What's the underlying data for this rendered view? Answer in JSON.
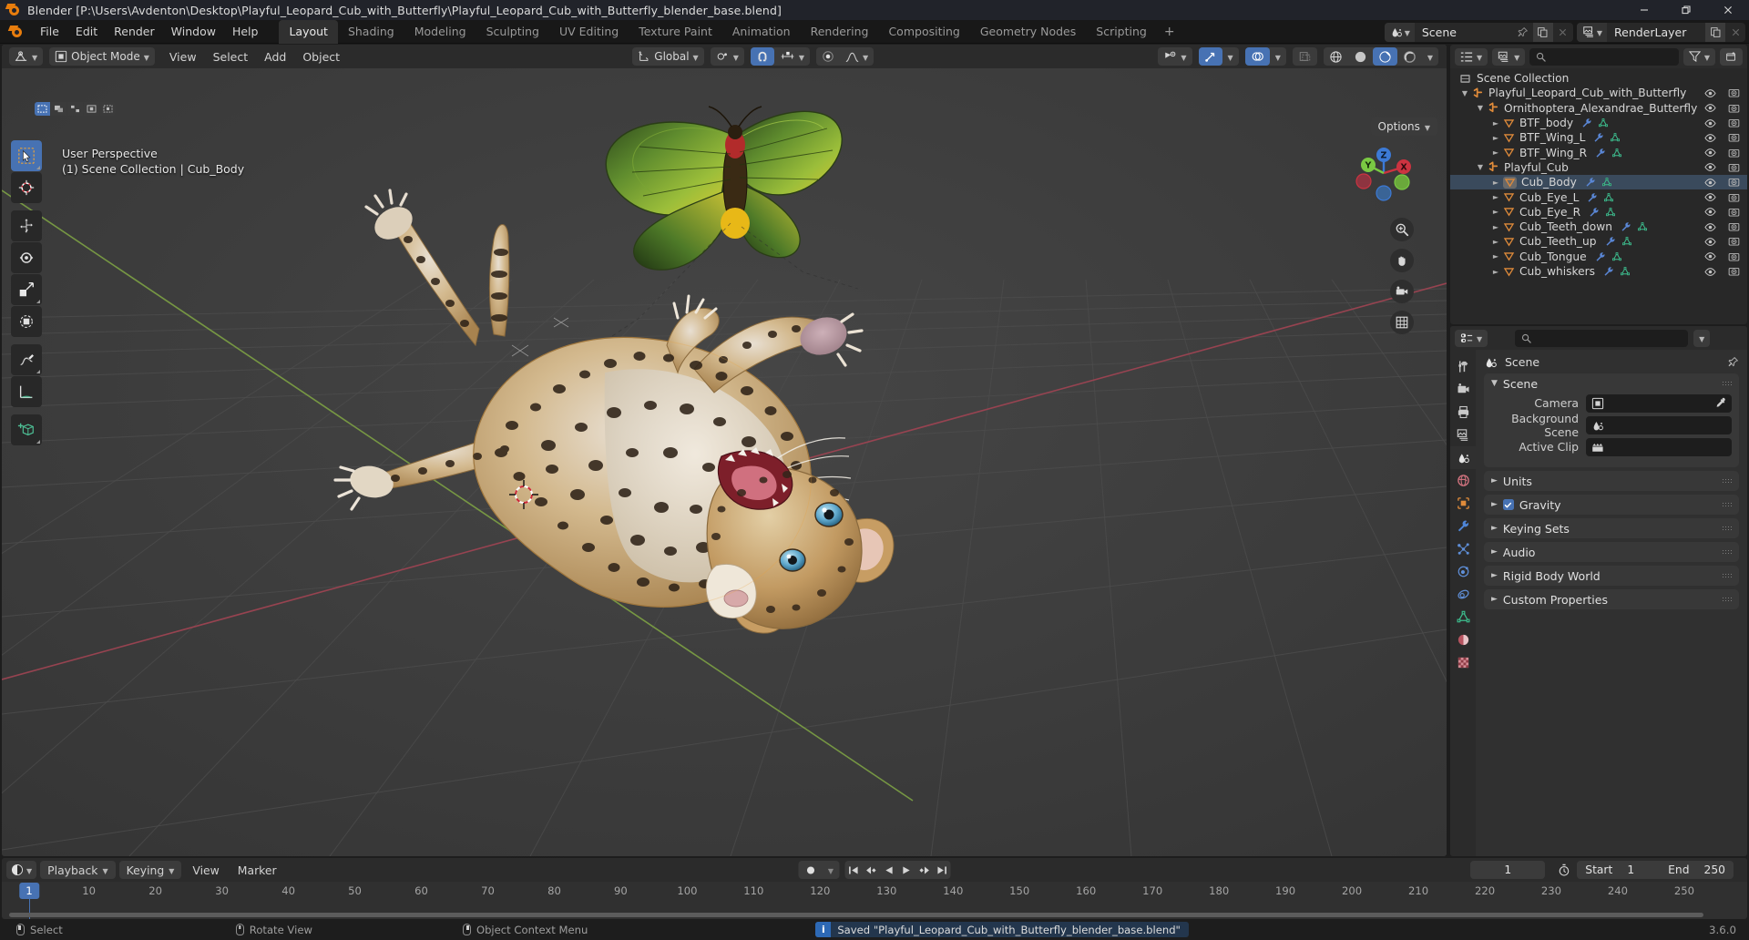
{
  "window": {
    "title": "Blender [P:\\Users\\Avdenton\\Desktop\\Playful_Leopard_Cub_with_Butterfly\\Playful_Leopard_Cub_with_Butterfly_blender_base.blend]",
    "minimize_label": "—",
    "maximize_label": "❐",
    "close_label": "✕"
  },
  "topbar": {
    "menus": [
      "File",
      "Edit",
      "Render",
      "Window",
      "Help"
    ],
    "workspaces": [
      "Layout",
      "Shading",
      "Modeling",
      "Sculpting",
      "UV Editing",
      "Texture Paint",
      "Animation",
      "Rendering",
      "Compositing",
      "Geometry Nodes",
      "Scripting"
    ],
    "active_workspace": "Layout",
    "add_workspace_label": "+",
    "scene_name": "Scene",
    "viewlayer_name": "RenderLayer"
  },
  "viewport": {
    "mode": "Object Mode",
    "menus": [
      "View",
      "Select",
      "Add",
      "Object"
    ],
    "transform_orientation": "Global",
    "options_label": "Options",
    "overlay_line1": "User Perspective",
    "overlay_line2": "(1) Scene Collection | Cub_Body",
    "gizmo_axes": [
      "X",
      "Y",
      "Z"
    ],
    "tools": [
      "tweak-select-tool",
      "cursor-tool",
      "move-tool",
      "rotate-tool",
      "scale-tool",
      "transform-tool",
      "annotate-tool",
      "measure-tool",
      "add-cube-tool"
    ],
    "select_modes": [
      "set-new",
      "extend",
      "subtract",
      "invert",
      "intersect"
    ],
    "shading_modes": [
      "wireframe",
      "solid",
      "material-preview",
      "rendered"
    ],
    "active_shading_mode": "material-preview",
    "nav_buttons": [
      "zoom-navigate",
      "pan-navigate",
      "camera-view",
      "toggle-orthographic"
    ]
  },
  "outliner": {
    "search_placeholder": "",
    "root": "Scene Collection",
    "rows": [
      {
        "label": "Playful_Leopard_Cub_with_Butterfly",
        "indent": 0,
        "type": "collection",
        "expanded": true,
        "disclosure": "down",
        "modifier": false,
        "mesh": false,
        "selected": false
      },
      {
        "label": "Ornithoptera_Alexandrae_Butterfly",
        "indent": 1,
        "type": "collection",
        "expanded": true,
        "disclosure": "down",
        "modifier": false,
        "mesh": false,
        "selected": false
      },
      {
        "label": "BTF_body",
        "indent": 2,
        "type": "object",
        "expanded": false,
        "disclosure": "right",
        "modifier": true,
        "mesh": true,
        "selected": false
      },
      {
        "label": "BTF_Wing_L",
        "indent": 2,
        "type": "object",
        "expanded": false,
        "disclosure": "right",
        "modifier": true,
        "mesh": true,
        "selected": false
      },
      {
        "label": "BTF_Wing_R",
        "indent": 2,
        "type": "object",
        "expanded": false,
        "disclosure": "right",
        "modifier": true,
        "mesh": true,
        "selected": false
      },
      {
        "label": "Playful_Cub",
        "indent": 1,
        "type": "collection",
        "expanded": true,
        "disclosure": "down",
        "modifier": false,
        "mesh": false,
        "selected": false
      },
      {
        "label": "Cub_Body",
        "indent": 2,
        "type": "object",
        "expanded": false,
        "disclosure": "right",
        "modifier": true,
        "mesh": true,
        "selected": true
      },
      {
        "label": "Cub_Eye_L",
        "indent": 2,
        "type": "object",
        "expanded": false,
        "disclosure": "right",
        "modifier": true,
        "mesh": true,
        "selected": false
      },
      {
        "label": "Cub_Eye_R",
        "indent": 2,
        "type": "object",
        "expanded": false,
        "disclosure": "right",
        "modifier": true,
        "mesh": true,
        "selected": false
      },
      {
        "label": "Cub_Teeth_down",
        "indent": 2,
        "type": "object",
        "expanded": false,
        "disclosure": "right",
        "modifier": true,
        "mesh": true,
        "selected": false
      },
      {
        "label": "Cub_Teeth_up",
        "indent": 2,
        "type": "object",
        "expanded": false,
        "disclosure": "right",
        "modifier": true,
        "mesh": true,
        "selected": false
      },
      {
        "label": "Cub_Tongue",
        "indent": 2,
        "type": "object",
        "expanded": false,
        "disclosure": "right",
        "modifier": true,
        "mesh": true,
        "selected": false
      },
      {
        "label": "Cub_whiskers",
        "indent": 2,
        "type": "object",
        "expanded": false,
        "disclosure": "right",
        "modifier": true,
        "mesh": true,
        "selected": false
      }
    ]
  },
  "properties": {
    "search_placeholder": "",
    "breadcrumb": "Scene",
    "tabs": [
      "tool-tab",
      "render-tab",
      "output-tab",
      "view-layer-tab",
      "scene-tab",
      "world-tab",
      "object-tab",
      "modifiers-tab",
      "particles-tab",
      "physics-tab",
      "constraints-tab",
      "data-tab",
      "material-tab",
      "texture-tab"
    ],
    "active_tab": "scene-tab",
    "panels": [
      {
        "title": "Scene",
        "open": true,
        "checkbox": null
      },
      {
        "title": "Units",
        "open": false,
        "checkbox": null
      },
      {
        "title": "Gravity",
        "open": false,
        "checkbox": true
      },
      {
        "title": "Keying Sets",
        "open": false,
        "checkbox": null
      },
      {
        "title": "Audio",
        "open": false,
        "checkbox": null
      },
      {
        "title": "Rigid Body World",
        "open": false,
        "checkbox": null
      },
      {
        "title": "Custom Properties",
        "open": false,
        "checkbox": null
      }
    ],
    "scene_fields": [
      {
        "label": "Camera",
        "value": "",
        "icon": "camera-icon",
        "eyedropper": true
      },
      {
        "label": "Background Scene",
        "value": "",
        "icon": "scene-icon",
        "eyedropper": false
      },
      {
        "label": "Active Clip",
        "value": "",
        "icon": "clip-icon",
        "eyedropper": false
      }
    ]
  },
  "timeline": {
    "menus": [
      "View",
      "Marker"
    ],
    "playback_label": "Playback",
    "keying_label": "Keying",
    "current_frame": "1",
    "start_label": "Start",
    "start_value": "1",
    "end_label": "End",
    "end_value": "250",
    "ticks": [
      10,
      20,
      30,
      40,
      50,
      60,
      70,
      80,
      90,
      100,
      110,
      120,
      130,
      140,
      150,
      160,
      170,
      180,
      190,
      200,
      210,
      220,
      230,
      240,
      250
    ],
    "playhead_frame": 1,
    "transport_buttons": [
      "jump-start",
      "prev-keyframe",
      "play-reverse",
      "play",
      "next-keyframe",
      "jump-end"
    ]
  },
  "statusbar": {
    "items": [
      {
        "mouse": "lmb",
        "label": "Select"
      },
      {
        "mouse": "mmb",
        "label": "Rotate View"
      },
      {
        "mouse": "rmb",
        "label": "Object Context Menu"
      }
    ],
    "report_icon": "i",
    "report_text": "Saved \"Playful_Leopard_Cub_with_Butterfly_blender_base.blend\"",
    "version": "3.6.0"
  },
  "colors": {
    "accent_blue": "#4772b3",
    "orange": "#e87d0d",
    "axis_x": "#cc3340",
    "axis_y": "#7ac943",
    "axis_z": "#3c7ad6",
    "mesh_green": "#3dbf8f",
    "modifier_blue": "#5a87d6"
  }
}
